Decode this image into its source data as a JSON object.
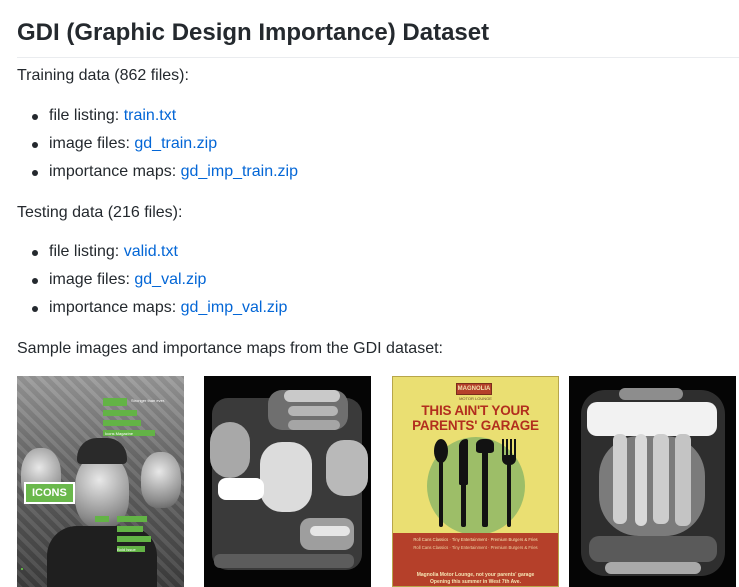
{
  "heading": "GDI (Graphic Design Importance) Dataset",
  "training": {
    "intro": "Training data (862 files):",
    "items": [
      {
        "label": "file listing: ",
        "link": "train.txt"
      },
      {
        "label": "image files: ",
        "link": "gd_train.zip"
      },
      {
        "label": "importance maps: ",
        "link": "gd_imp_train.zip"
      }
    ]
  },
  "testing": {
    "intro": "Testing data (216 files):",
    "items": [
      {
        "label": "file listing: ",
        "link": "valid.txt"
      },
      {
        "label": "image files: ",
        "link": "gd_val.zip"
      },
      {
        "label": "importance maps: ",
        "link": "gd_imp_val.zip"
      }
    ]
  },
  "samples_intro": "Sample images and importance maps from the GDI dataset:",
  "poster1": {
    "logo": "ICONS",
    "tags": [
      "Stronger than ever.",
      "Icons Magazine",
      "Bold Issue"
    ]
  },
  "poster2": {
    "badge": "MAGNOLIA",
    "subtitle": "MOTOR LOUNGE",
    "title_line1": "THIS AIN'T YOUR",
    "title_line2": "PARENTS' GARAGE",
    "footer_small": "Roll Cans Classics · Tiny Entertainment · Premium Burgers & Fries",
    "footer_line1": "Magnolia Motor Lounge, not your parents' garage",
    "footer_line2": "Opening this summer in West 7th Ave."
  },
  "colors": {
    "link": "#0366d6",
    "text": "#24292e",
    "poster_red": "#b5402a",
    "poster_yellow": "#eadf72",
    "poster_green": "#9dbe68",
    "icons_green": "#63b346"
  }
}
